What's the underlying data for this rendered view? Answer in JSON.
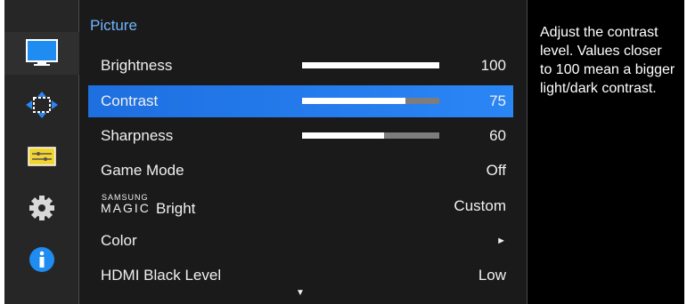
{
  "sidebar": {
    "items": [
      {
        "icon": "picture-icon",
        "active": true
      },
      {
        "icon": "onscreen-display-icon",
        "active": false
      },
      {
        "icon": "setup-icon",
        "active": false
      },
      {
        "icon": "settings-gear-icon",
        "active": false
      },
      {
        "icon": "information-icon",
        "active": false
      }
    ]
  },
  "menu": {
    "title": "Picture",
    "items": [
      {
        "label": "Brightness",
        "value": "100",
        "level": 1.0
      },
      {
        "label": "Contrast",
        "value": "75",
        "level": 0.75,
        "selected": true
      },
      {
        "label": "Sharpness",
        "value": "60",
        "level": 0.6
      },
      {
        "label": "Game Mode",
        "value": "Off"
      },
      {
        "label_brand_top": "SAMSUNG",
        "label_brand": "MAGIC",
        "label": "Bright",
        "value": "Custom"
      },
      {
        "label": "Color",
        "value": "►"
      },
      {
        "label": "HDMI Black Level",
        "value": "Low"
      }
    ],
    "scroll_indicator": "▼"
  },
  "help": {
    "text": "Adjust the contrast level. Values closer to 100 mean a bigger light/dark contrast."
  },
  "colors": {
    "selection": "#2b86f5",
    "title": "#6eb4ff",
    "bar_fill": "#ffffff",
    "bar_track": "#7d7d7d"
  }
}
